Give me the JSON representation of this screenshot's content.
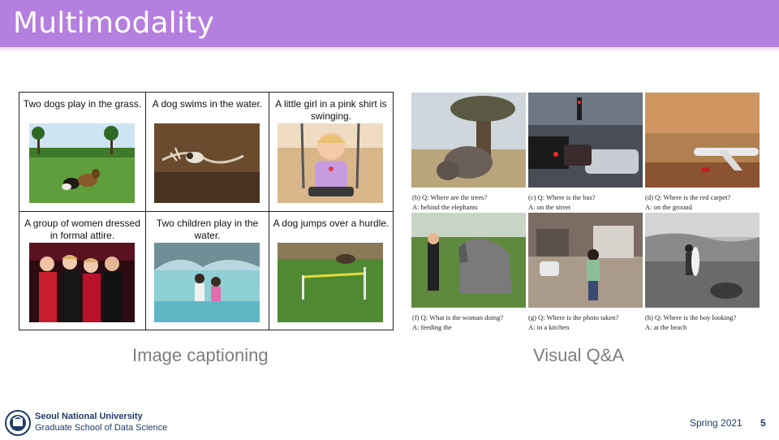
{
  "slide": {
    "title": "Multimodality",
    "page_number": "5",
    "term": "Spring 2021"
  },
  "captioning": {
    "label": "Image captioning",
    "cells": [
      {
        "caption": "Two dogs play in the grass.",
        "icon": "dogs-on-grass-photo"
      },
      {
        "caption": "A dog swims in the water.",
        "icon": "dog-swimming-photo"
      },
      {
        "caption": "A little girl in a pink shirt is swinging.",
        "icon": "girl-on-swing-photo"
      },
      {
        "caption": "A group of women dressed in formal attire.",
        "icon": "women-formal-photo"
      },
      {
        "caption": "Two children play in the water.",
        "icon": "children-in-water-photo"
      },
      {
        "caption": "A dog jumps over a hurdle.",
        "icon": "dog-hurdle-photo"
      }
    ]
  },
  "vqa": {
    "label": "Visual Q&A",
    "items": [
      {
        "q": "(b) Q: Where are the trees?",
        "a": "A: behind the elephants",
        "icon": "elephants-photo"
      },
      {
        "q": "(c) Q: Where is the bus?",
        "a": "A: on the street",
        "icon": "street-traffic-photo"
      },
      {
        "q": "(d) Q: Where is the red carpet?",
        "a": "A: on the ground",
        "icon": "airplane-photo"
      },
      {
        "q": "(f) Q: What is the woman doing?",
        "a": "A: feeding the",
        "icon": "woman-horse-photo"
      },
      {
        "q": "(g) Q: Where is the photo taken?",
        "a": "A: in a kitchen",
        "icon": "kitchen-photo"
      },
      {
        "q": "(h) Q: Where is the boy looking?",
        "a": "A: at the beach",
        "icon": "beach-surfer-photo"
      }
    ]
  },
  "footer": {
    "university": "Seoul National University",
    "school": "Graduate School of Data Science",
    "logo_icon": "snu-logo-icon"
  },
  "colors": {
    "title_bar": "#b57fdf",
    "footer_text": "#1f3a66",
    "label_gray": "#7d7d7d"
  }
}
